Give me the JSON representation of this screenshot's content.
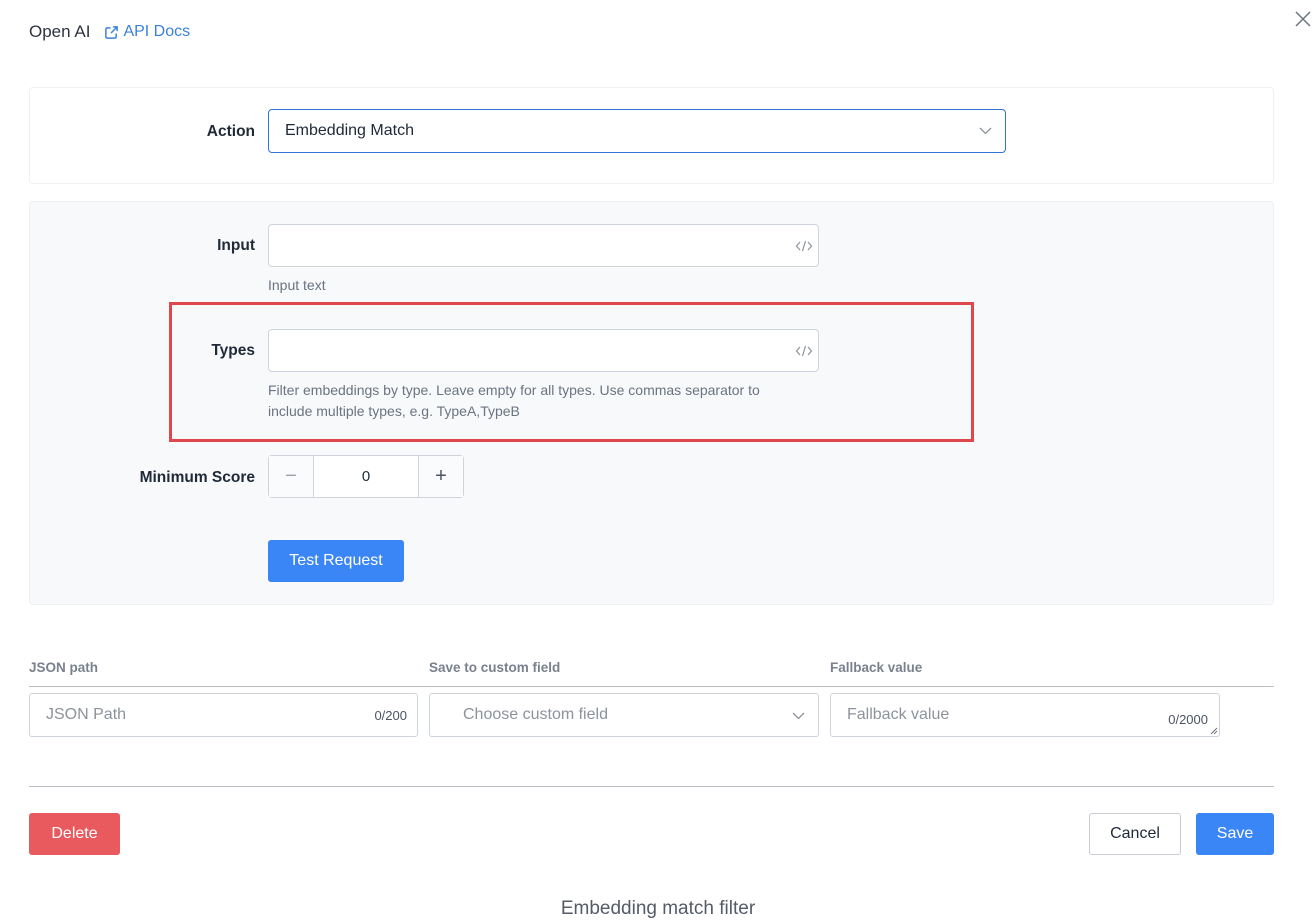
{
  "header": {
    "title": "Open AI",
    "api_docs_label": "API Docs"
  },
  "action": {
    "label": "Action",
    "selected": "Embedding Match"
  },
  "input": {
    "label": "Input",
    "value": "",
    "help": "Input text"
  },
  "types": {
    "label": "Types",
    "value": "",
    "help_line1": "Filter embeddings by type. Leave empty for all types. Use commas separator to",
    "help_line2": "include multiple types, e.g. TypeA,TypeB"
  },
  "minimum_score": {
    "label": "Minimum Score",
    "value": "0",
    "minus": "−",
    "plus": "+"
  },
  "test_request_label": "Test Request",
  "mapping": {
    "json_path_header": "JSON path",
    "custom_field_header": "Save to custom field",
    "fallback_header": "Fallback value",
    "json_path_placeholder": "JSON Path",
    "json_path_counter": "0/200",
    "custom_field_placeholder": "Choose custom field",
    "fallback_placeholder": "Fallback value",
    "fallback_counter": "0/2000"
  },
  "footer": {
    "delete_label": "Delete",
    "cancel_label": "Cancel",
    "save_label": "Save"
  },
  "caption": "Embedding match filter",
  "colors": {
    "primary": "#3b86f7",
    "danger": "#e85a5e",
    "highlight": "#e0474a",
    "link": "#3a82d8"
  }
}
